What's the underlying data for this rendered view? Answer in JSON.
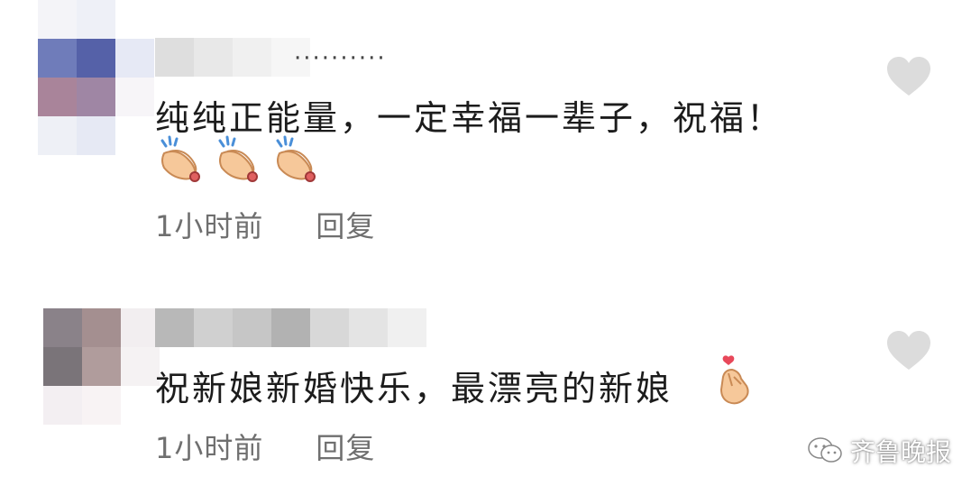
{
  "comments": [
    {
      "name_suffix": "··········",
      "text": "纯纯正能量，一定幸福一辈子，祝福！",
      "emojis": [
        "clap-hands",
        "clap-hands",
        "clap-hands"
      ],
      "time": "1小时前",
      "reply": "回复"
    },
    {
      "text": "祝新娘新婚快乐，最漂亮的新娘",
      "emojis": [
        "finger-heart"
      ],
      "time": "1小时前",
      "reply": "回复"
    }
  ],
  "watermark": {
    "text": "齐鲁晚报",
    "icon": "wechat-icon"
  },
  "colors": {
    "like_heart": "#dcdcdc",
    "meta_text": "#6f6f6f"
  }
}
